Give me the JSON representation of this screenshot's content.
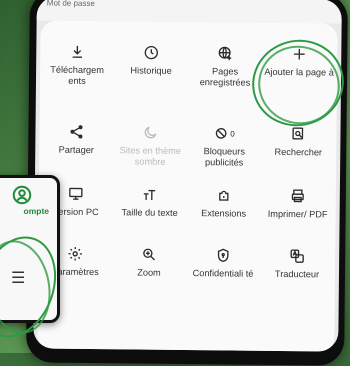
{
  "topbar": {
    "text": "Mot de passe"
  },
  "menu": {
    "row1": [
      {
        "icon": "download-icon",
        "label": "Téléchargem ents"
      },
      {
        "icon": "clock-icon",
        "label": "Historique"
      },
      {
        "icon": "globe-plus-icon",
        "label": "Pages enregistrées"
      },
      {
        "icon": "plus-icon",
        "label": "Ajouter la page à"
      }
    ],
    "row2": [
      {
        "icon": "share-icon",
        "label": "Partager"
      },
      {
        "icon": "moon-icon",
        "label": "Sites en thème sombre"
      },
      {
        "icon": "block-icon",
        "label": "Bloqueurs publicités",
        "badge": "0"
      },
      {
        "icon": "search-page-icon",
        "label": "Rechercher"
      }
    ],
    "row3": [
      {
        "icon": "desktop-icon",
        "label": "Version PC"
      },
      {
        "icon": "text-size-icon",
        "label": "Taille du texte"
      },
      {
        "icon": "extensions-icon",
        "label": "Extensions"
      },
      {
        "icon": "print-icon",
        "label": "Imprimer/ PDF"
      }
    ],
    "row4": [
      {
        "icon": "settings-icon",
        "label": "Paramètres"
      },
      {
        "icon": "zoom-icon",
        "label": "Zoom"
      },
      {
        "icon": "privacy-icon",
        "label": "Confidentiali té"
      },
      {
        "icon": "translate-icon",
        "label": "Traducteur"
      }
    ]
  },
  "leftcard": {
    "label": "ompte"
  },
  "colors": {
    "accent": "#2e9a45"
  }
}
